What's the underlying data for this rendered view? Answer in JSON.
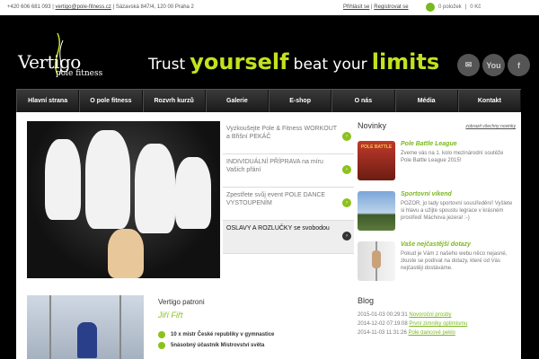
{
  "topbar": {
    "phone": "+420 606 681 093",
    "email": "vertigo@pole-fitness.cz",
    "address": "Sázavská 847/4, 120 00 Praha 2",
    "login": "Přihlásit se",
    "register": "Registrovat se",
    "cart_items": "0 položek",
    "cart_total": "0 Kč"
  },
  "logo": {
    "name": "Vertigo",
    "sub": "pole fitness"
  },
  "tagline": {
    "part1": "Trust",
    "part2": "yourself",
    "part3": "beat your",
    "part4": "limits"
  },
  "social": {
    "mail": "✉",
    "youtube": "You",
    "facebook": "f"
  },
  "nav": [
    "Hlavní strana",
    "O pole fitness",
    "Rozvrh kurzů",
    "Galerie",
    "E-shop",
    "O nás",
    "Média",
    "Kontakt"
  ],
  "promos": [
    "Vyzkoušejte Pole & Fitness WORKOUT a Břišní PEKÁČ",
    "INDIVIDUÁLNÍ PŘÍPRAVA na míru Vašich přání",
    "Zpestřete svůj event POLE DANCE VYSTOUPENÍM",
    "OSLAVY A ROZLUČKY se svobodou"
  ],
  "news": {
    "title": "Novinky",
    "more": "zobrazit všechny novinky",
    "items": [
      {
        "title": "Pole Battle League",
        "text": "Zveme vás na 1. kolo mezinárodní soutěže Pole Battle League 2015!",
        "thumb": "POLE BATTLE"
      },
      {
        "title": "Sportovní víkend",
        "text": "POZOR, jo lady sportovní sousíředění! Vyšlete si hlavu a užijte spoustu legrace v krásném prostředí Máchova jezera! :-)"
      },
      {
        "title": "Vaše nejčastější dotazy",
        "text": "Pokud je Vám z našeho webu něco nejasné, zkuste se podívat na dotazy, které od Vás nejčastěji dostáváme."
      }
    ]
  },
  "patron": {
    "title": "Vertigo patroni",
    "name": "Jiří Fiřt",
    "facts": [
      "10 x mistr České republiky v gymnastice",
      "5násobný účastník Mistrovství světa"
    ]
  },
  "blog": {
    "title": "Blog",
    "rows": [
      {
        "date": "2015-01-03 00:29:31",
        "link": "Novoroční prosby"
      },
      {
        "date": "2014-12-02 07:19:08",
        "link": "První zimníky optimismu"
      },
      {
        "date": "2014-11-03 11:31:26",
        "link": "Pole dancové peklo"
      }
    ]
  },
  "colors": {
    "accent": "#8cc21c",
    "tagline_green": "#c4e11f",
    "background": "#000000"
  }
}
